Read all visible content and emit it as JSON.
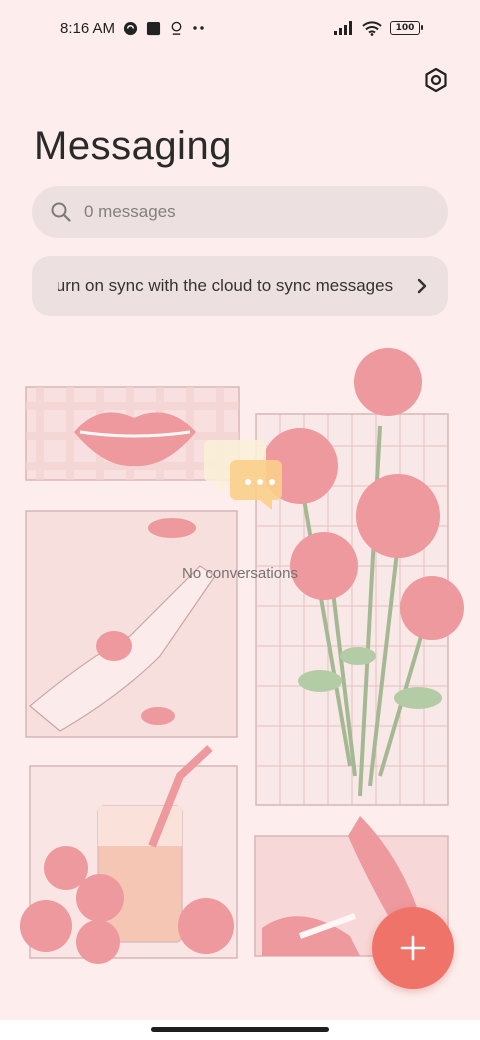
{
  "status_bar": {
    "time": "8:16 AM",
    "battery": "100",
    "icons": [
      "whatsapp-icon",
      "square-app-icon",
      "badge-icon",
      "more-dots-icon",
      "signal-icon",
      "wifi-icon",
      "battery-icon"
    ]
  },
  "header": {
    "title": "Messaging",
    "settings_icon": "gear-icon"
  },
  "search": {
    "placeholder": "0 messages",
    "icon": "search-icon"
  },
  "sync_banner": {
    "text": "Turn on sync with the cloud to sync messages",
    "icon": "chevron-right-icon"
  },
  "empty_state": {
    "label": "No conversations",
    "icon": "chat-bubbles-icon"
  },
  "fab": {
    "icon": "plus-icon",
    "color": "#f0736a"
  },
  "colors": {
    "background": "#fdeeed",
    "surface": "#ece0e0",
    "accent": "#f0736a"
  }
}
